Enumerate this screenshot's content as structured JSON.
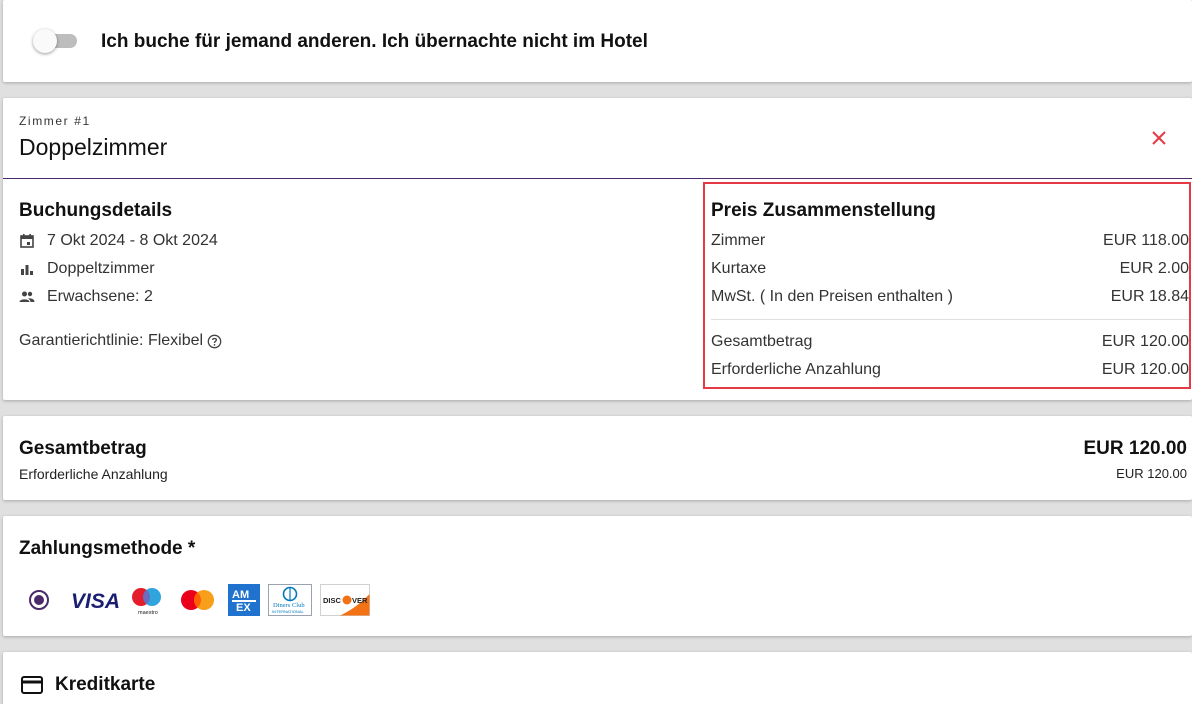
{
  "toggle": {
    "label": "Ich buche für jemand anderen. Ich übernachte nicht im Hotel",
    "checked": false
  },
  "room": {
    "overline": "Zimmer #1",
    "title": "Doppelzimmer",
    "details_title": "Buchungsdetails",
    "dates": "7 Okt 2024 - 8 Okt 2024",
    "room_type": "Doppeltzimmer",
    "guests": "Erwachsene: 2",
    "guarantee": "Garantierichtlinie: Flexibel",
    "accent_color": "#4a2a6b",
    "close_color": "#e53945"
  },
  "price": {
    "title": "Preis Zusammenstellung",
    "rows": [
      {
        "label": "Zimmer",
        "value": "EUR 118.00"
      },
      {
        "label": "Kurtaxe",
        "value": "EUR 2.00"
      },
      {
        "label": "MwSt. ( In den Preisen enthalten )",
        "value": "EUR 18.84"
      },
      {
        "label": "Gesamtbetrag",
        "value": "EUR 120.00"
      },
      {
        "label": "Erforderliche Anzahlung",
        "value": "EUR 120.00"
      }
    ]
  },
  "total": {
    "title": "Gesamtbetrag",
    "amount": "EUR 120.00",
    "deposit_label": "Erforderliche Anzahlung",
    "deposit_amount": "EUR 120.00"
  },
  "payment": {
    "title": "Zahlungsmethode *",
    "methods": [
      "visa-logo",
      "maestro-logo",
      "mastercard-logo",
      "amex-logo",
      "diners-club-logo",
      "discover-logo"
    ]
  },
  "credit": {
    "title": "Kreditkarte"
  }
}
